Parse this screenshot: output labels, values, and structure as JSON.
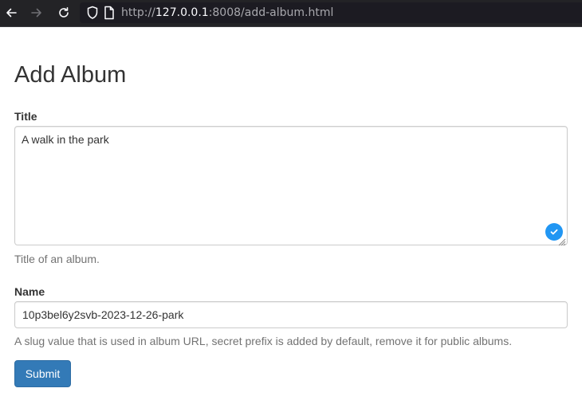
{
  "browser": {
    "url_prefix": "http://",
    "url_host": "127.0.0.1",
    "url_rest": ":8008/add-album.html",
    "icons": [
      "back-arrow-icon",
      "forward-arrow-icon",
      "reload-icon",
      "shield-icon",
      "page-icon"
    ]
  },
  "page": {
    "title": "Add Album"
  },
  "form": {
    "title_label": "Title",
    "title_value": "A walk in the park",
    "title_help": "Title of an album.",
    "name_label": "Name",
    "name_value": "10p3bel6y2svb-2023-12-26-park",
    "name_help": "A slug value that is used in album URL, secret prefix is added by default, remove it for public albums.",
    "submit_label": "Submit"
  },
  "colors": {
    "primary": "#337ab7",
    "check_badge": "#2196f3",
    "help_text": "#737373",
    "chrome_bg": "#232326"
  }
}
